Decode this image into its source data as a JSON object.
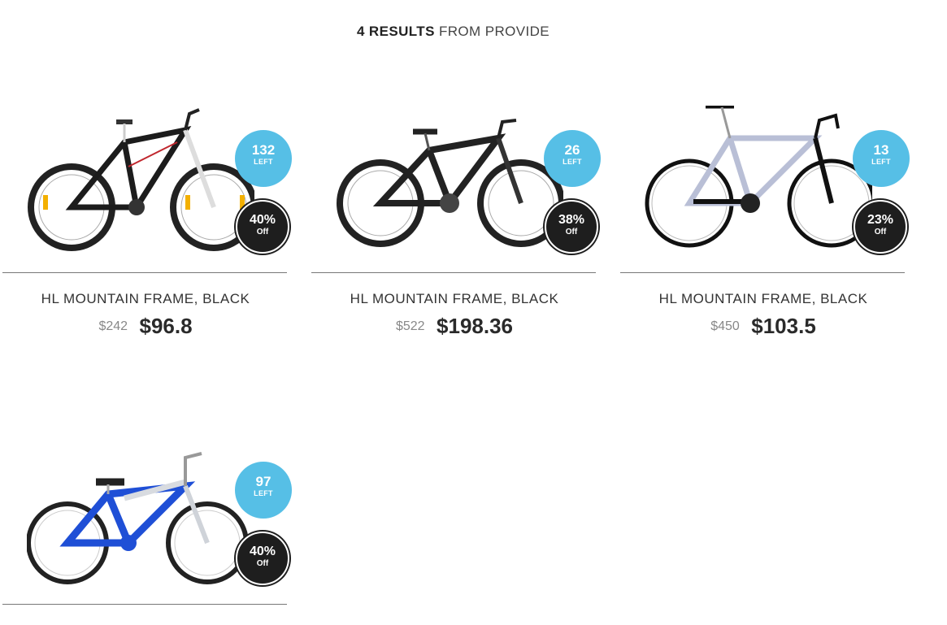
{
  "heading": {
    "count": "4 RESULTS",
    "rest": "FROM PROVIDE"
  },
  "products": [
    {
      "title": "HL MOUNTAIN FRAME, BLACK",
      "old_price": "$242",
      "new_price": "$96.8",
      "left_count": "132",
      "left_label": "LEFT",
      "discount": "40%",
      "discount_label": "Off",
      "image": "black-mountain-bike",
      "frame_color": "#1c1c1c"
    },
    {
      "title": "HL MOUNTAIN FRAME, BLACK",
      "old_price": "$522",
      "new_price": "$198.36",
      "left_count": "26",
      "left_label": "LEFT",
      "discount": "38%",
      "discount_label": "Off",
      "image": "black-hybrid-bike",
      "frame_color": "#222222"
    },
    {
      "title": "HL MOUNTAIN FRAME, BLACK",
      "old_price": "$450",
      "new_price": "$103.5",
      "left_count": "13",
      "left_label": "LEFT",
      "discount": "23%",
      "discount_label": "Off",
      "image": "silver-road-bike",
      "frame_color": "#b9bfd6"
    },
    {
      "left_count": "97",
      "left_label": "LEFT",
      "discount": "40%",
      "discount_label": "Off",
      "image": "blue-cruiser-bike",
      "frame_color": "#1f4fd6"
    }
  ],
  "colors": {
    "left_badge": "#56bfe6",
    "off_badge": "#1e1e1e"
  }
}
